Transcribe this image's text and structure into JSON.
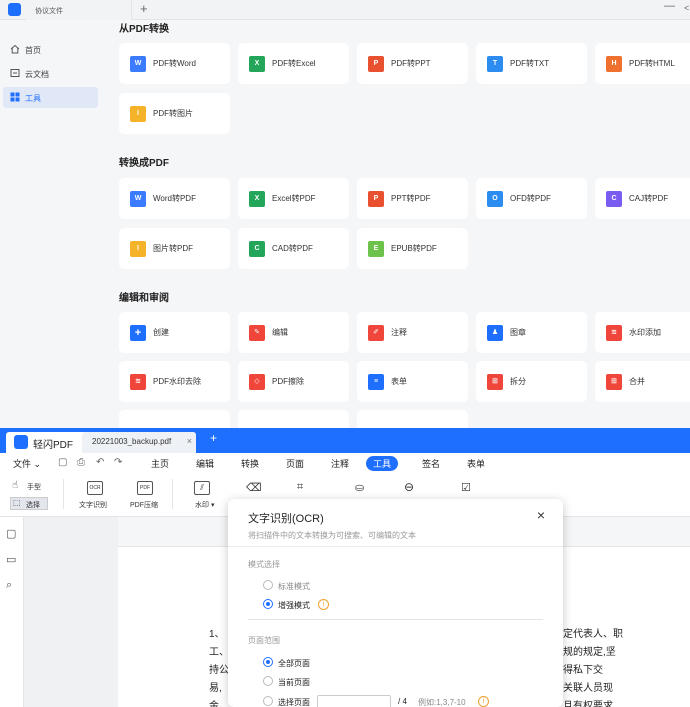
{
  "top_window": {
    "tab_title": "协议文件",
    "new_tab": "+",
    "win_minimize": "—",
    "win_more": "&lt;",
    "sidebar": [
      {
        "label": "首页",
        "icon": "home-icon"
      },
      {
        "label": "云文档",
        "icon": "cloud-doc-icon"
      },
      {
        "label": "工具",
        "icon": "tools-grid-icon",
        "active": true
      }
    ],
    "sections": [
      {
        "title": "从PDF转换",
        "cards": [
          {
            "label": "PDF转Word",
            "icon": "W",
            "color": "#3a7bff"
          },
          {
            "label": "PDF转Excel",
            "icon": "X",
            "color": "#23a55a"
          },
          {
            "label": "PDF转PPT",
            "icon": "P",
            "color": "#e8502f"
          },
          {
            "label": "PDF转TXT",
            "icon": "T",
            "color": "#2d8cf0"
          },
          {
            "label": "PDF转HTML",
            "icon": "H",
            "color": "#f07030"
          },
          {
            "label": "PDF转图片",
            "icon": "I",
            "color": "#f5b32a"
          }
        ]
      },
      {
        "title": "转换成PDF",
        "cards": [
          {
            "label": "Word转PDF",
            "icon": "W",
            "color": "#3a7bff"
          },
          {
            "label": "Excel转PDF",
            "icon": "X",
            "color": "#23a55a"
          },
          {
            "label": "PPT转PDF",
            "icon": "P",
            "color": "#e8502f"
          },
          {
            "label": "OFD转PDF",
            "icon": "O",
            "color": "#2d8cf0"
          },
          {
            "label": "CAJ转PDF",
            "icon": "C",
            "color": "#7b5cf0"
          },
          {
            "label": "图片转PDF",
            "icon": "I",
            "color": "#f5b32a"
          },
          {
            "label": "CAD转PDF",
            "icon": "C",
            "color": "#23a55a"
          },
          {
            "label": "EPUB转PDF",
            "icon": "E",
            "color": "#6cc24a"
          }
        ]
      },
      {
        "title": "编辑和审阅",
        "cards": [
          {
            "label": "创建",
            "icon": "+",
            "color": "#1f6fff"
          },
          {
            "label": "编辑",
            "icon": "✎",
            "color": "#f0453a"
          },
          {
            "label": "注释",
            "icon": "✐",
            "color": "#f0453a"
          },
          {
            "label": "图章",
            "icon": "♟",
            "color": "#1f6fff"
          },
          {
            "label": "水印添加",
            "icon": "≋",
            "color": "#f0453a"
          },
          {
            "label": "PDF水印去除",
            "icon": "≋",
            "color": "#f0453a"
          },
          {
            "label": "PDF擦除",
            "icon": "◇",
            "color": "#f0453a"
          },
          {
            "label": "表单",
            "icon": "≡",
            "color": "#1f6fff"
          },
          {
            "label": "拆分",
            "icon": "⊞",
            "color": "#f0453a"
          },
          {
            "label": "合并",
            "icon": "⊞",
            "color": "#f0453a"
          }
        ]
      }
    ]
  },
  "bottom_window": {
    "app_name": "轻闪PDF",
    "file_tab": "20221003_backup.pdf",
    "close_glyph": "×",
    "new_tab": "+",
    "menu": [
      "文件",
      "主页",
      "编辑",
      "转换",
      "页面",
      "注释",
      "工具",
      "签名",
      "表单"
    ],
    "menu_active": "工具",
    "toolbar": {
      "hand": "手型",
      "select": "选择",
      "ocr_box": "OCR",
      "ocr_label": "文字识别",
      "pdf_box": "PDF",
      "compress_label": "PDF压缩",
      "watermark_label": "水印"
    },
    "document_lines": [
      {
        "left": "1、",
        "right": "定代表人、职"
      },
      {
        "left": "工、",
        "right": "规的规定,坚"
      },
      {
        "left": "持公",
        "right": "得私下交"
      },
      {
        "left": "易,",
        "right": "关联人员现"
      },
      {
        "left": "金、",
        "right": "且有权要求"
      }
    ],
    "ocr_dialog": {
      "title": "文字识别(OCR)",
      "close": "×",
      "description": "将扫描件中的文本转换为可搜索、可编辑的文本",
      "mode_label": "模式选择",
      "modes": [
        {
          "label": "标准模式",
          "selected": false
        },
        {
          "label": "增强模式",
          "selected": true
        }
      ],
      "info_glyph": "i",
      "range_label": "页面范围",
      "ranges": [
        {
          "label": "全部页面",
          "selected": true
        },
        {
          "label": "当前页面",
          "selected": false
        },
        {
          "label": "选择页面",
          "selected": false
        }
      ],
      "page_total": "/ 4",
      "page_example": "例如:1,3,7-10"
    }
  }
}
